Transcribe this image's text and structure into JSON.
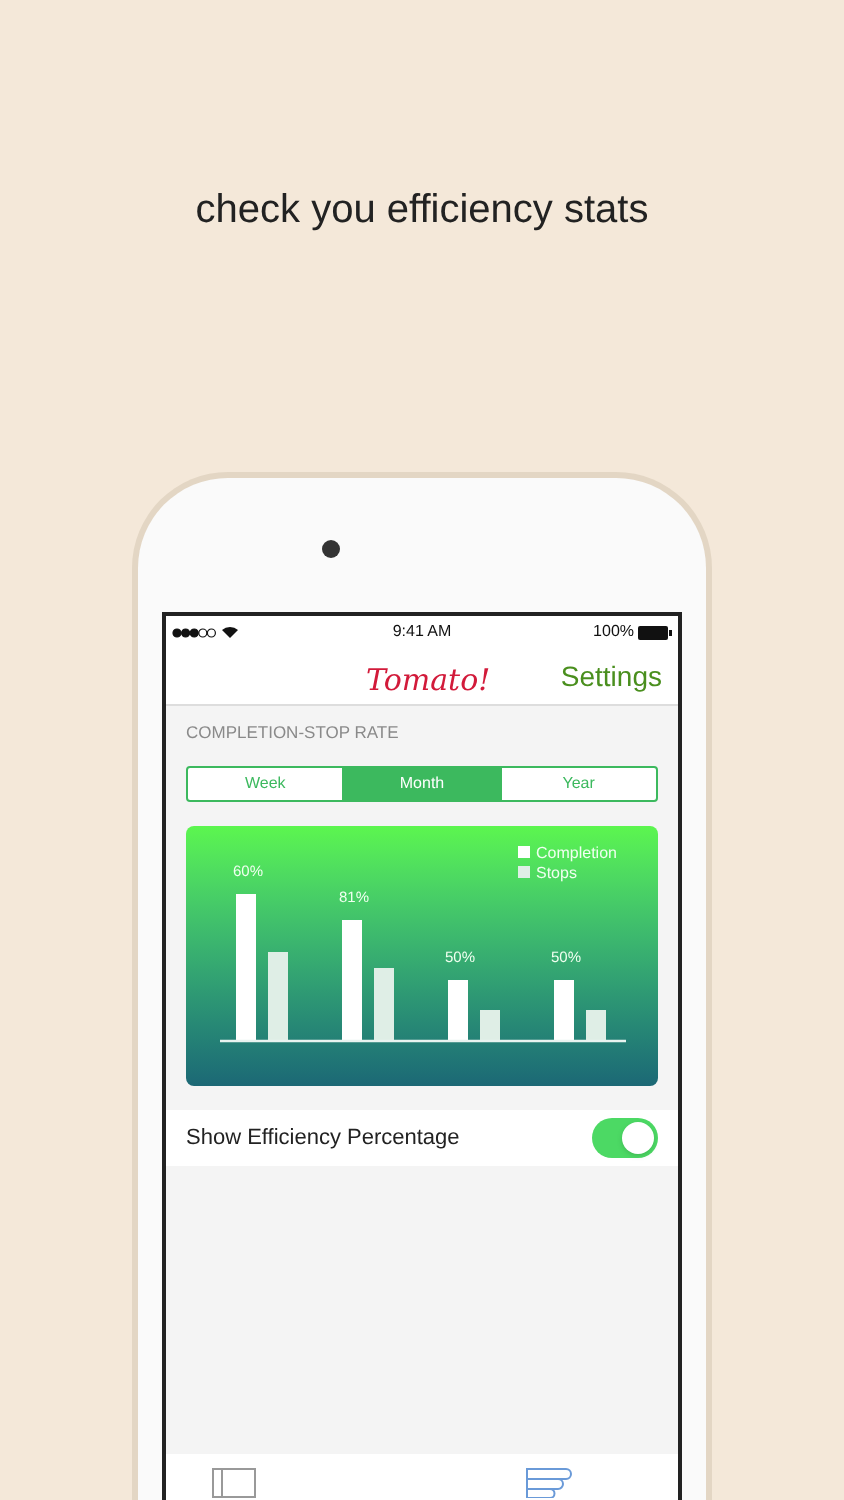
{
  "headline": "check you efficiency stats",
  "status_bar": {
    "time": "9:41 AM",
    "battery": "100%"
  },
  "nav": {
    "title": "Tomato!",
    "action": "Settings"
  },
  "section_header": "COMPLETION-STOP RATE",
  "segments": [
    {
      "label": "Week",
      "selected": false
    },
    {
      "label": "Month",
      "selected": true
    },
    {
      "label": "Year",
      "selected": false
    }
  ],
  "chart": {
    "legend": [
      "Completion",
      "Stops"
    ],
    "groups": [
      {
        "label": "60%"
      },
      {
        "label": "81%"
      },
      {
        "label": "50%"
      },
      {
        "label": "50%"
      }
    ]
  },
  "setting": {
    "label": "Show Efficiency Percentage",
    "on": true
  }
}
